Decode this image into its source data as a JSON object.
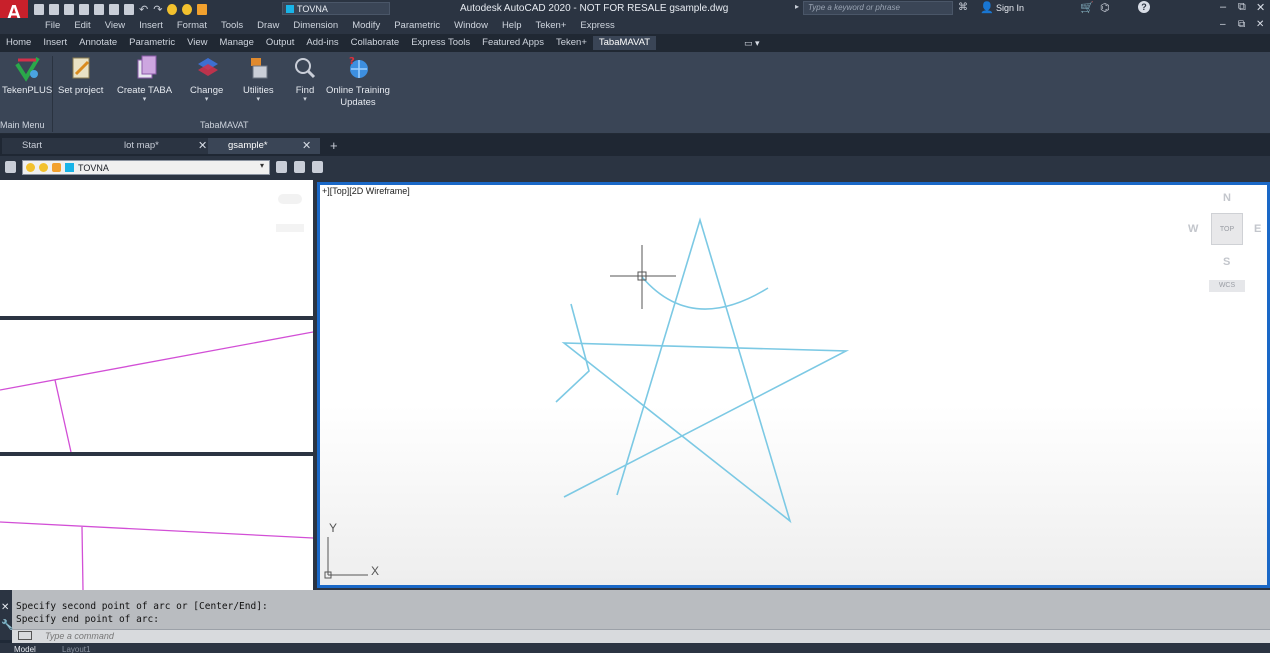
{
  "app": {
    "logo": "A",
    "title": "Autodesk AutoCAD 2020 - NOT FOR RESALE   gsample.dwg",
    "qat_layer": "TOVNA",
    "search_placeholder": "Type a keyword or phrase",
    "sign_in": "Sign In"
  },
  "menus": [
    "File",
    "Edit",
    "View",
    "Insert",
    "Format",
    "Tools",
    "Draw",
    "Dimension",
    "Modify",
    "Parametric",
    "Window",
    "Help",
    "Teken+",
    "Express"
  ],
  "ribbon_tabs": [
    {
      "label": "Home"
    },
    {
      "label": "Insert"
    },
    {
      "label": "Annotate"
    },
    {
      "label": "Parametric"
    },
    {
      "label": "View"
    },
    {
      "label": "Manage"
    },
    {
      "label": "Output"
    },
    {
      "label": "Add-ins"
    },
    {
      "label": "Collaborate"
    },
    {
      "label": "Express Tools"
    },
    {
      "label": "Featured Apps"
    },
    {
      "label": "Teken+"
    },
    {
      "label": "TabaMAVAT",
      "active": true
    }
  ],
  "ribbon": {
    "tools": {
      "tekenplus": "TekenPLUS",
      "set_project": "Set project",
      "create_taba": "Create TABA",
      "change": "Change",
      "utilities": "Utilities",
      "find": "Find",
      "online_training_1": "Online Training",
      "online_training_2": "Updates"
    },
    "panel_main": "Main Menu",
    "panel_taba": "TabaMAVAT"
  },
  "file_tabs": {
    "start": "Start",
    "lot_map": "lot map*",
    "gsample": "gsample*"
  },
  "layer_toolbar": {
    "layer_name": "TOVNA"
  },
  "viewport": {
    "label": "+][Top][2D Wireframe]",
    "viewcube": {
      "n": "N",
      "s": "S",
      "e": "E",
      "w": "W",
      "top": "TOP",
      "wcs": "WCS"
    },
    "ucs": {
      "x": "X",
      "y": "Y"
    }
  },
  "command": {
    "history": [
      "Specify second point of arc or [Center/End]:",
      "Specify end point of arc:"
    ],
    "placeholder": "Type a command"
  },
  "status": {
    "model": "Model",
    "layout": "Layout1"
  },
  "colors": {
    "accent_blue": "#1a68c7",
    "drawing_cyan": "#7cc9e4",
    "magenta_line": "#d24fd6"
  }
}
